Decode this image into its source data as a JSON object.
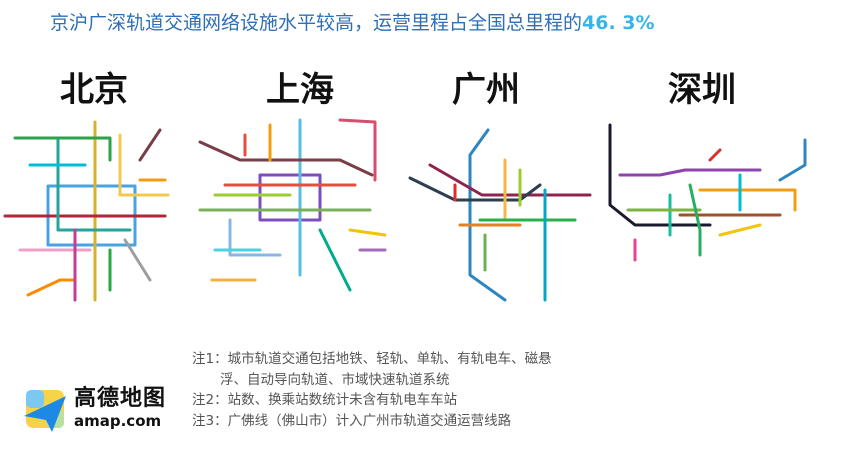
{
  "title": {
    "text": "京沪广深轨道交通网络设施水平较高，运营里程占全国总里程的",
    "percentage": "46. 3%"
  },
  "cities": [
    "北京",
    "上海",
    "广州",
    "深圳"
  ],
  "notes": [
    "注1：城市轨道交通包括地铁、轻轨、单轨、有轨电车、磁悬",
    "浮、自动导向轨道、市域快速轨道系统",
    "注2：站数、换乘站数统计未含有轨电车车站",
    "注3：广佛线（佛山市）计入广州市轨道交通运营线路"
  ],
  "logo": {
    "name_cn": "高德地图",
    "name_en": "amap.com"
  },
  "colors": {
    "title": "#2f6fb3",
    "percentage": "#36b6e8"
  }
}
